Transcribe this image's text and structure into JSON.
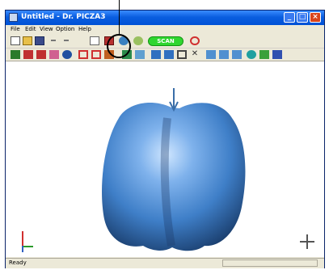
{
  "window": {
    "title": "Untitled - Dr. PICZA3"
  },
  "titlebar_buttons": {
    "minimize": "_",
    "maximize": "□",
    "close": "×"
  },
  "menu": [
    "File",
    "Edit",
    "View",
    "Option",
    "Help"
  ],
  "toolbar": {
    "scan_label": "SCAN"
  },
  "status": {
    "text": "Ready"
  },
  "icons": [
    "new-file-icon",
    "open-folder-icon",
    "save-icon",
    "copy-icon",
    "rotate-icon",
    "scan-icon",
    "zoom-icon",
    "view-icon",
    "select-icon",
    "move-icon",
    "delete-icon",
    "sphere-icon",
    "axes-icon",
    "move-cursor-icon"
  ],
  "colors": {
    "titlebar": "#0a5ee0",
    "scan_button": "#2fd62f",
    "object": "#3f7fc8"
  }
}
